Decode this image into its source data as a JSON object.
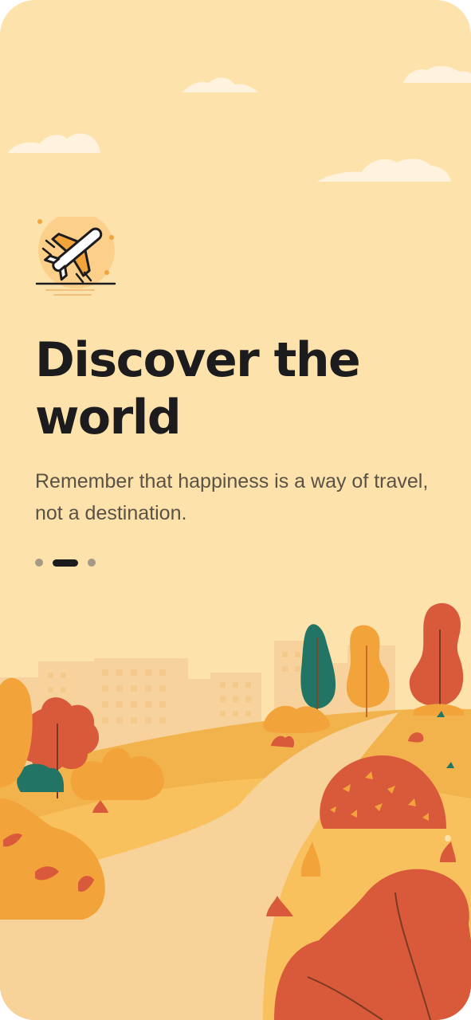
{
  "onboarding": {
    "title": "Discover the world",
    "subtitle": "Remember that happiness is a way of travel, not a destination.",
    "icon": "airplane-icon",
    "pager": {
      "pages": 3,
      "current_index": 1
    }
  },
  "colors": {
    "background": "#fde3ab",
    "title": "#1c1c1e",
    "subtitle": "#5a5246",
    "dot_inactive": "#a59a85",
    "dot_active": "#1c1c1e",
    "accent_orange": "#f2a33a",
    "accent_red": "#d95a3a",
    "accent_teal": "#227565"
  }
}
